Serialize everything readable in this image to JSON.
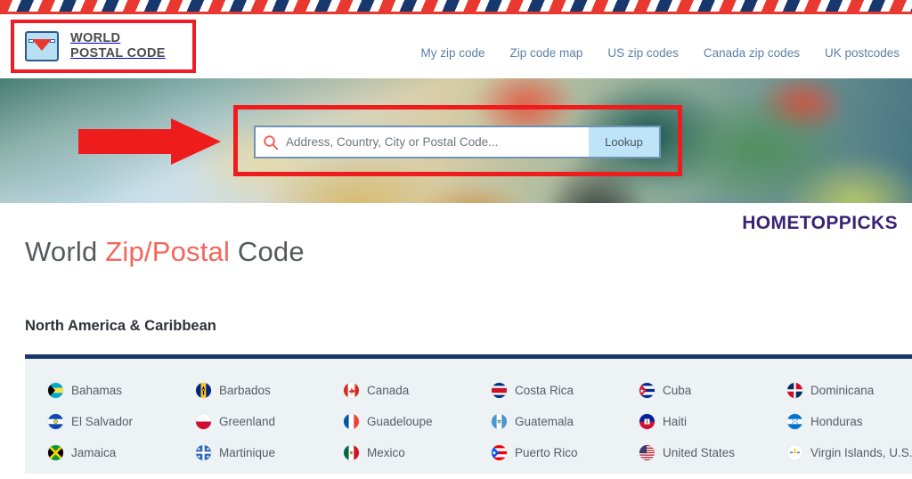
{
  "header": {
    "logo": {
      "icon": "envelope-icon",
      "line1": "WORLD",
      "line2": "POSTAL CODE"
    },
    "nav": [
      {
        "label": "My zip code"
      },
      {
        "label": "Zip code map"
      },
      {
        "label": "US zip codes"
      },
      {
        "label": "Canada zip codes"
      },
      {
        "label": "UK postcodes"
      }
    ]
  },
  "hero": {
    "search": {
      "icon": "search-icon",
      "placeholder": "Address, Country, City or Postal Code...",
      "value": "",
      "button_label": "Lookup"
    },
    "annotations": {
      "arrow": "red-arrow-pointer",
      "highlight_box": "red-highlight-rectangle"
    }
  },
  "watermark": {
    "text": "HOMETOPPICKS",
    "color": "#3b2374"
  },
  "main": {
    "title_prefix": "World ",
    "title_accent": "Zip/Postal",
    "title_suffix": " Code",
    "accent_color": "#f4665c",
    "region_heading": "North America & Caribbean",
    "countries": [
      {
        "name": "Bahamas",
        "flag": "bs"
      },
      {
        "name": "Barbados",
        "flag": "bb"
      },
      {
        "name": "Canada",
        "flag": "ca"
      },
      {
        "name": "Costa Rica",
        "flag": "cr"
      },
      {
        "name": "Cuba",
        "flag": "cu"
      },
      {
        "name": "Dominicana",
        "flag": "do"
      },
      {
        "name": "El Salvador",
        "flag": "sv"
      },
      {
        "name": "Greenland",
        "flag": "gl"
      },
      {
        "name": "Guadeloupe",
        "flag": "gp"
      },
      {
        "name": "Guatemala",
        "flag": "gt"
      },
      {
        "name": "Haiti",
        "flag": "ht"
      },
      {
        "name": "Honduras",
        "flag": "hn"
      },
      {
        "name": "Jamaica",
        "flag": "jm"
      },
      {
        "name": "Martinique",
        "flag": "mq"
      },
      {
        "name": "Mexico",
        "flag": "mx"
      },
      {
        "name": "Puerto Rico",
        "flag": "pr"
      },
      {
        "name": "United States",
        "flag": "us"
      },
      {
        "name": "Virgin Islands, U.S.",
        "flag": "vi"
      }
    ]
  }
}
